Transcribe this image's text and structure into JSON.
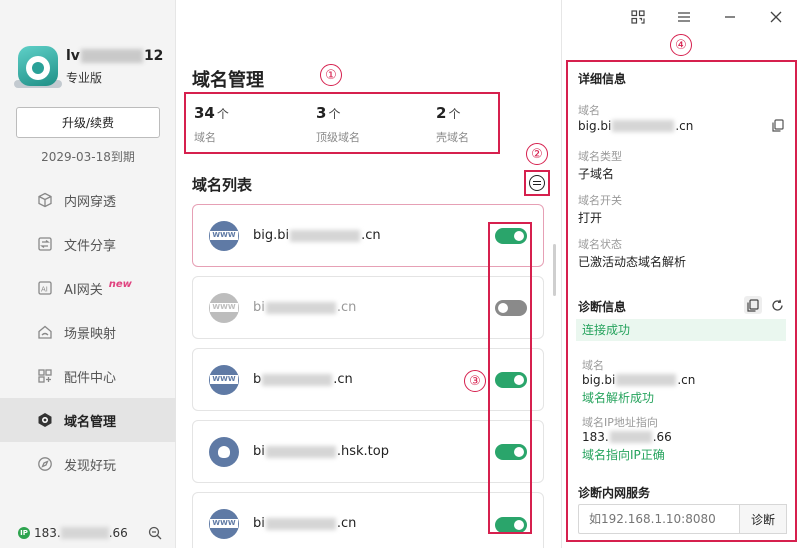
{
  "user": {
    "name_prefix": "lv",
    "name_suffix": "12",
    "edition": "专业版"
  },
  "upgrade_label": "升级/续费",
  "expire_text": "2029-03-18到期",
  "nav": [
    {
      "label": "内网穿透",
      "icon": "cube-icon"
    },
    {
      "label": "文件分享",
      "icon": "file-share-icon"
    },
    {
      "label": "AI网关",
      "icon": "ai-icon",
      "badge": "new"
    },
    {
      "label": "场景映射",
      "icon": "home-icon"
    },
    {
      "label": "配件中心",
      "icon": "grid-icon"
    },
    {
      "label": "域名管理",
      "icon": "domain-icon",
      "active": true
    },
    {
      "label": "发现好玩",
      "icon": "discover-icon"
    }
  ],
  "footer": {
    "ip_badge": "IP",
    "ip_prefix": "183.",
    "ip_suffix": ".66"
  },
  "main": {
    "title": "域名管理",
    "stats": [
      {
        "num": "34",
        "unit": "个",
        "label": "域名"
      },
      {
        "num": "3",
        "unit": "个",
        "label": "顶级域名"
      },
      {
        "num": "2",
        "unit": "个",
        "label": "壳域名"
      }
    ],
    "list_title": "域名列表",
    "domains": [
      {
        "prefix": "big.bi",
        "suffix": ".cn",
        "enabled": true,
        "selected": true,
        "icon": "www"
      },
      {
        "prefix": "bi",
        "suffix": ".cn",
        "enabled": false,
        "icon": "www"
      },
      {
        "prefix": "b",
        "suffix": ".cn",
        "enabled": true,
        "icon": "www"
      },
      {
        "prefix": "bi",
        "suffix": ".hsk.top",
        "enabled": true,
        "icon": "shield"
      },
      {
        "prefix": "bi",
        "suffix": ".cn",
        "enabled": true,
        "icon": "www"
      }
    ]
  },
  "annotations": [
    "①",
    "②",
    "③",
    "④"
  ],
  "detail": {
    "title": "详细信息",
    "domain_label": "域名",
    "domain_prefix": "big.bi",
    "domain_suffix": ".cn",
    "type_label": "域名类型",
    "type_value": "子域名",
    "switch_label": "域名开关",
    "switch_value": "打开",
    "status_label": "域名状态",
    "status_value": "已激活动态域名解析"
  },
  "diagnosis": {
    "title": "诊断信息",
    "result": "连接成功",
    "domain_label": "域名",
    "domain_prefix": "big.bi",
    "domain_suffix": ".cn",
    "domain_result": "域名解析成功",
    "ip_label": "域名IP地址指向",
    "ip_prefix": "183.",
    "ip_suffix": ".66",
    "ip_result": "域名指向IP正确"
  },
  "intranet": {
    "title": "诊断内网服务",
    "placeholder": "如192.168.1.10:8080",
    "button": "诊断"
  },
  "colors": {
    "accent_red": "#d6204e",
    "toggle_on": "#2aa56b",
    "success": "#26a35d"
  }
}
